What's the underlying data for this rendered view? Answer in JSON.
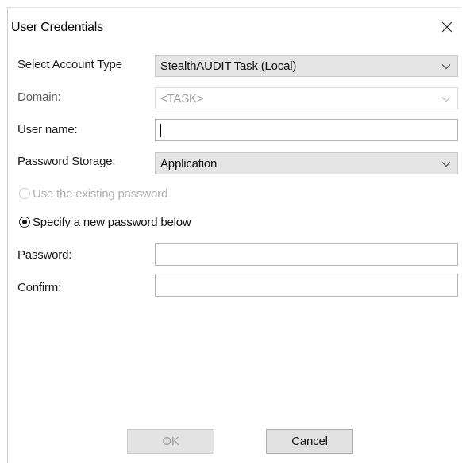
{
  "window": {
    "title": "User Credentials",
    "close_icon": "close-x"
  },
  "form": {
    "account_type": {
      "label": "Select Account Type",
      "value": "StealthAUDIT Task (Local)"
    },
    "domain": {
      "label": "Domain:",
      "value": "<TASK>",
      "enabled": false
    },
    "username": {
      "label": "User name:",
      "value": ""
    },
    "password_storage": {
      "label": "Password Storage:",
      "value": "Application"
    },
    "radio_existing": {
      "label": "Use the existing password",
      "checked": false,
      "enabled": false
    },
    "radio_new": {
      "label": "Specify a new password below",
      "checked": true,
      "enabled": true
    },
    "password": {
      "label": "Password:",
      "value": ""
    },
    "confirm": {
      "label": "Confirm:",
      "value": ""
    }
  },
  "buttons": {
    "ok": {
      "label": "OK",
      "enabled": false
    },
    "cancel": {
      "label": "Cancel",
      "enabled": true
    }
  },
  "icons": {
    "dropdown": "chevron-down-icon",
    "close": "close-icon"
  }
}
